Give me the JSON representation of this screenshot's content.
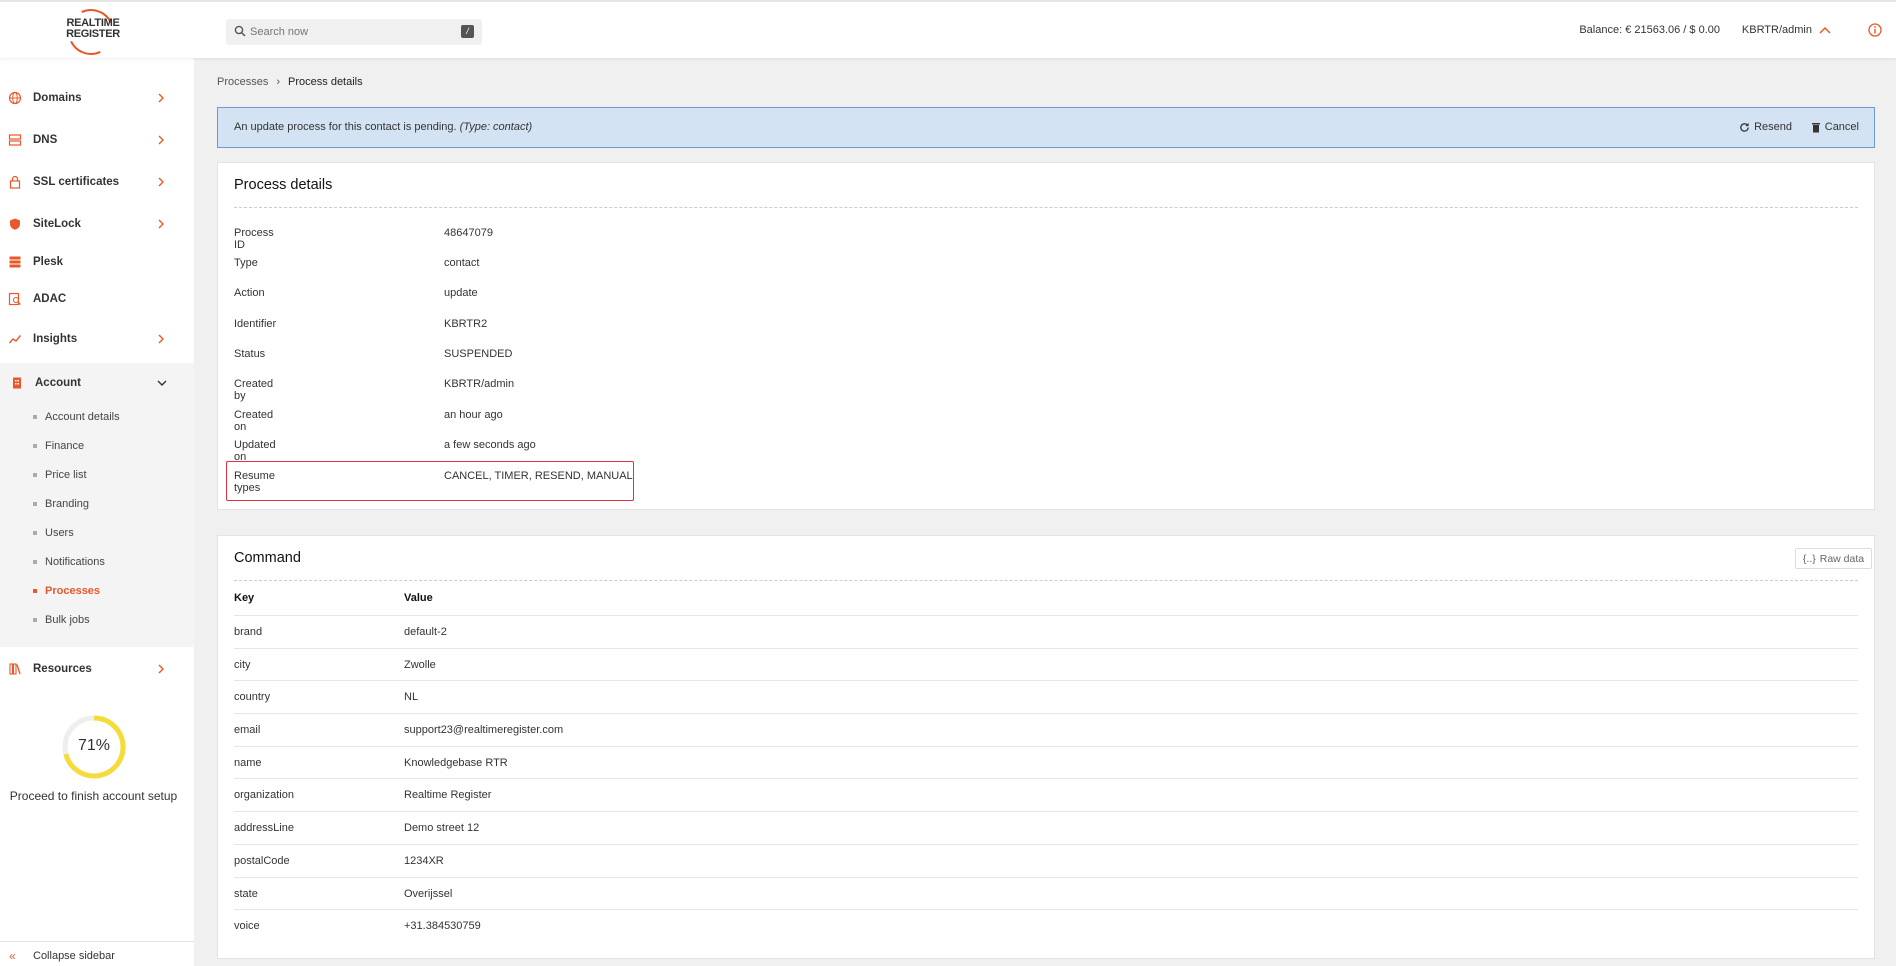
{
  "app": {
    "logo_line1": "REALTIME",
    "logo_line2": "REGISTER",
    "accent": "#e8582b"
  },
  "header": {
    "search_placeholder": "Search now",
    "search_shortcut": "/",
    "balance": "Balance: € 21563.06 / $ 0.00",
    "user": "KBRTR/admin"
  },
  "sidebar": {
    "items": [
      {
        "label": "Domains",
        "icon": "globe-icon"
      },
      {
        "label": "DNS",
        "icon": "server-icon"
      },
      {
        "label": "SSL certificates",
        "icon": "lock-icon"
      },
      {
        "label": "SiteLock",
        "icon": "shield-icon"
      },
      {
        "label": "Plesk",
        "icon": "stack-icon"
      },
      {
        "label": "ADAC",
        "icon": "search-doc-icon"
      },
      {
        "label": "Insights",
        "icon": "chart-icon"
      }
    ],
    "account": {
      "label": "Account",
      "children": [
        "Account details",
        "Finance",
        "Price list",
        "Branding",
        "Users",
        "Notifications",
        "Processes",
        "Bulk jobs"
      ],
      "active": "Processes"
    },
    "resources": "Resources",
    "setup_progress": 0.71,
    "setup_progress_label": "71%",
    "setup_caption": "Proceed to finish account setup",
    "collapse": "Collapse sidebar"
  },
  "breadcrumb": {
    "parent": "Processes",
    "current": "Process details"
  },
  "alert": {
    "message": "An update process for this contact is pending.",
    "type_note": "(Type: contact)",
    "resend": "Resend",
    "cancel": "Cancel"
  },
  "process": {
    "title": "Process details",
    "rows": [
      {
        "key": "Process ID",
        "value": "48647079"
      },
      {
        "key": "Type",
        "value": "contact"
      },
      {
        "key": "Action",
        "value": "update"
      },
      {
        "key": "Identifier",
        "value": "KBRTR2"
      },
      {
        "key": "Status",
        "value": "SUSPENDED"
      },
      {
        "key": "Created by",
        "value": "KBRTR/admin"
      },
      {
        "key": "Created on",
        "value": "an hour ago"
      },
      {
        "key": "Updated on",
        "value": "a few seconds ago"
      },
      {
        "key": "Resume types",
        "value": "CANCEL, TIMER, RESEND, MANUAL"
      }
    ]
  },
  "command": {
    "title": "Command",
    "raw_data": "Raw data",
    "key_header": "Key",
    "value_header": "Value",
    "rows": [
      {
        "key": "brand",
        "value": "default-2"
      },
      {
        "key": "city",
        "value": "Zwolle"
      },
      {
        "key": "country",
        "value": "NL"
      },
      {
        "key": "email",
        "value": "support23@realtimeregister.com"
      },
      {
        "key": "name",
        "value": "Knowledgebase RTR"
      },
      {
        "key": "organization",
        "value": "Realtime Register"
      },
      {
        "key": "addressLine",
        "value": "Demo street 12"
      },
      {
        "key": "postalCode",
        "value": "1234XR"
      },
      {
        "key": "state",
        "value": "Overijssel"
      },
      {
        "key": "voice",
        "value": "+31.384530759"
      }
    ]
  }
}
